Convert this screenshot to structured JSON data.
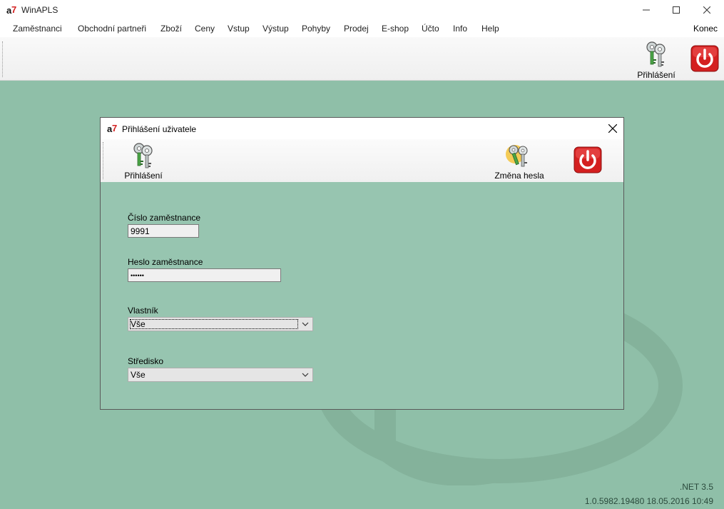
{
  "app": {
    "title": "WinAPLS"
  },
  "menu": {
    "items": [
      "Zaměstnanci",
      "Obchodní partneři",
      "Zboží",
      "Ceny",
      "Vstup",
      "Výstup",
      "Pohyby",
      "Prodej",
      "E-shop",
      "Účto",
      "Info",
      "Help"
    ],
    "right_item": "Konec"
  },
  "toolbar": {
    "login_label": "Přihlášení"
  },
  "dialog": {
    "title": "Přihlášení uživatele",
    "toolbar": {
      "login_label": "Přihlášení",
      "change_password_label": "Změna hesla"
    },
    "fields": {
      "employee_number": {
        "label": "Číslo zaměstnance",
        "value": "9991"
      },
      "employee_password": {
        "label": "Heslo zaměstnance",
        "value": "••••••"
      },
      "owner": {
        "label": "Vlastník",
        "value": "Vše"
      },
      "center": {
        "label": "Středisko",
        "value": "Vše"
      }
    }
  },
  "footer": {
    "framework": ".NET 3.5",
    "version": "1.0.5982.19480 18.05.2016 10:49"
  },
  "colors": {
    "background": "#8fbfa8",
    "dialog_bg": "#97c5b0",
    "power_red": "#d42020"
  }
}
